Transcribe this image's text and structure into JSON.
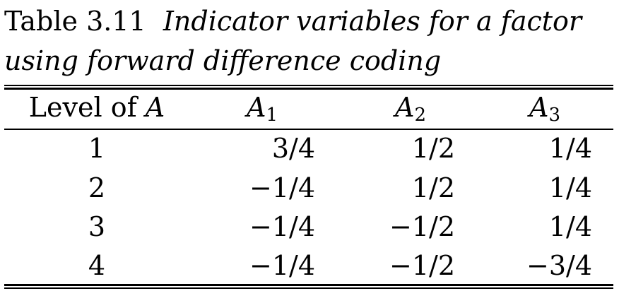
{
  "caption": {
    "label": "Table 3.11",
    "text": "Indicator variables for a factor using forward difference coding"
  },
  "table": {
    "header": {
      "level_prefix": "Level of ",
      "level_var": "A",
      "columns": [
        {
          "var": "A",
          "sub": "1"
        },
        {
          "var": "A",
          "sub": "2"
        },
        {
          "var": "A",
          "sub": "3"
        }
      ]
    },
    "rows": [
      {
        "level": "1",
        "a1": "3/4",
        "a2": "1/2",
        "a3": "1/4"
      },
      {
        "level": "2",
        "a1": "−1/4",
        "a2": "1/2",
        "a3": "1/4"
      },
      {
        "level": "3",
        "a1": "−1/4",
        "a2": "−1/2",
        "a3": "1/4"
      },
      {
        "level": "4",
        "a1": "−1/4",
        "a2": "−1/2",
        "a3": "−3/4"
      }
    ]
  }
}
